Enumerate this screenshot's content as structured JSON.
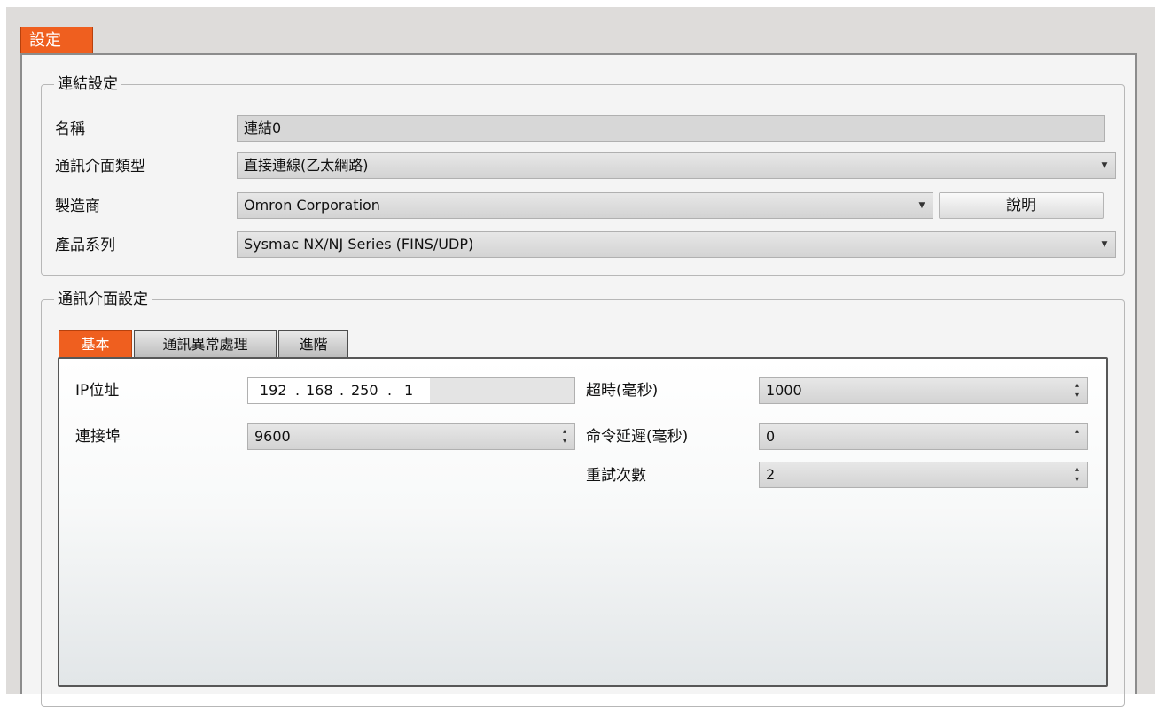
{
  "settings_tab": {
    "label": "設定"
  },
  "link_settings": {
    "title": "連結設定",
    "name": {
      "label": "名稱",
      "value": "連結0"
    },
    "interface_type": {
      "label": "通訊介面類型",
      "value": "直接連線(乙太網路)"
    },
    "manufacturer": {
      "label": "製造商",
      "value": "Omron Corporation",
      "help_button": "說明"
    },
    "product_series": {
      "label": "產品系列",
      "value": "Sysmac NX/NJ Series (FINS/UDP)"
    }
  },
  "interface_settings": {
    "title": "通訊介面設定",
    "tabs": [
      {
        "label": "基本",
        "active": true
      },
      {
        "label": "通訊異常處理",
        "active": false
      },
      {
        "label": "進階",
        "active": false
      }
    ],
    "basic": {
      "ip_address": {
        "label": "IP位址",
        "octets": [
          "192",
          "168",
          "250",
          "1"
        ],
        "separator": "."
      },
      "port": {
        "label": "連接埠",
        "value": "9600"
      },
      "timeout": {
        "label": "超時(毫秒)",
        "value": "1000"
      },
      "command_delay": {
        "label": "命令延遲(毫秒)",
        "value": "0"
      },
      "retry_count": {
        "label": "重試次數",
        "value": "2"
      }
    }
  },
  "icons": {
    "dropdown": "chevron-down-icon",
    "spinner": "spinner-arrows-icon",
    "spinner_up_glyph": "▴",
    "spinner_down_glyph": "▾",
    "dropdown_glyph": "▼"
  },
  "colors": {
    "accent_orange": "#ef5f1f",
    "panel_background": "#f4f4f4",
    "field_background": "#d7d7d7"
  }
}
